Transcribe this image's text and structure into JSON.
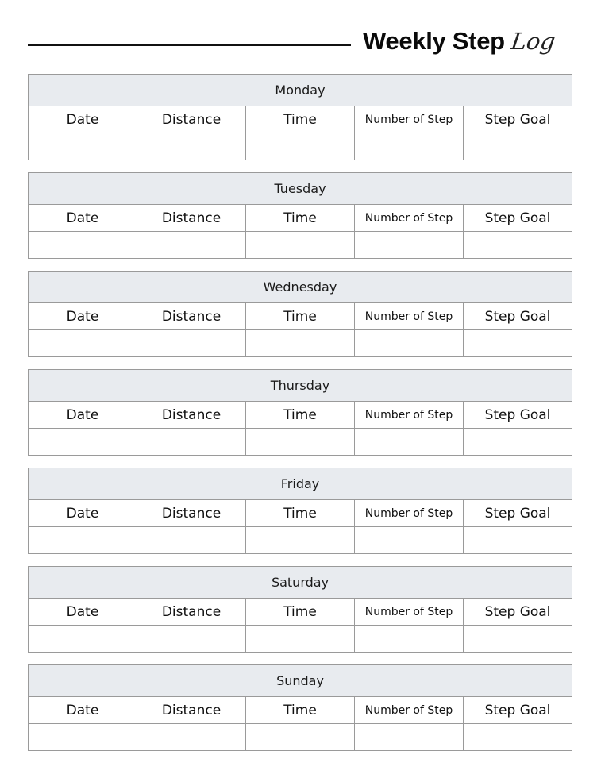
{
  "title": {
    "bold": "Weekly Step",
    "script": "Log"
  },
  "columns": [
    "Date",
    "Distance",
    "Time",
    "Number of Step",
    "Step Goal"
  ],
  "days": [
    "Monday",
    "Tuesday",
    "Wednesday",
    "Thursday",
    "Friday",
    "Saturday",
    "Sunday"
  ],
  "colors": {
    "header_fill": "#e8ebef",
    "border": "#9a9a9a",
    "text": "#111111"
  }
}
